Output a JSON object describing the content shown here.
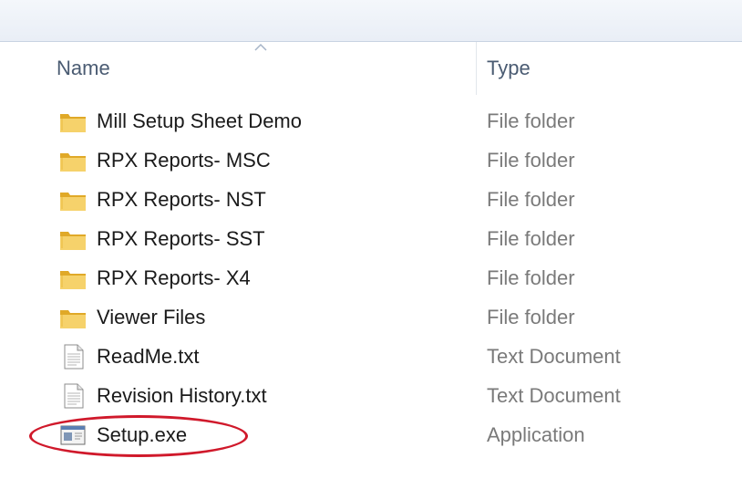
{
  "columns": {
    "name_label": "Name",
    "type_label": "Type",
    "sort_indicator": "ascending"
  },
  "files": [
    {
      "name": "Mill Setup Sheet Demo",
      "type": "File folder",
      "icon": "folder-icon"
    },
    {
      "name": "RPX Reports- MSC",
      "type": "File folder",
      "icon": "folder-icon"
    },
    {
      "name": "RPX Reports- NST",
      "type": "File folder",
      "icon": "folder-icon"
    },
    {
      "name": "RPX Reports- SST",
      "type": "File folder",
      "icon": "folder-icon"
    },
    {
      "name": "RPX Reports- X4",
      "type": "File folder",
      "icon": "folder-icon"
    },
    {
      "name": "Viewer Files",
      "type": "File folder",
      "icon": "folder-icon"
    },
    {
      "name": "ReadMe.txt",
      "type": "Text Document",
      "icon": "text-file-icon"
    },
    {
      "name": "Revision History.txt",
      "type": "Text Document",
      "icon": "text-file-icon"
    },
    {
      "name": "Setup.exe",
      "type": "Application",
      "icon": "application-icon"
    }
  ],
  "highlight": {
    "target": "Setup.exe",
    "color": "#d0192b"
  }
}
